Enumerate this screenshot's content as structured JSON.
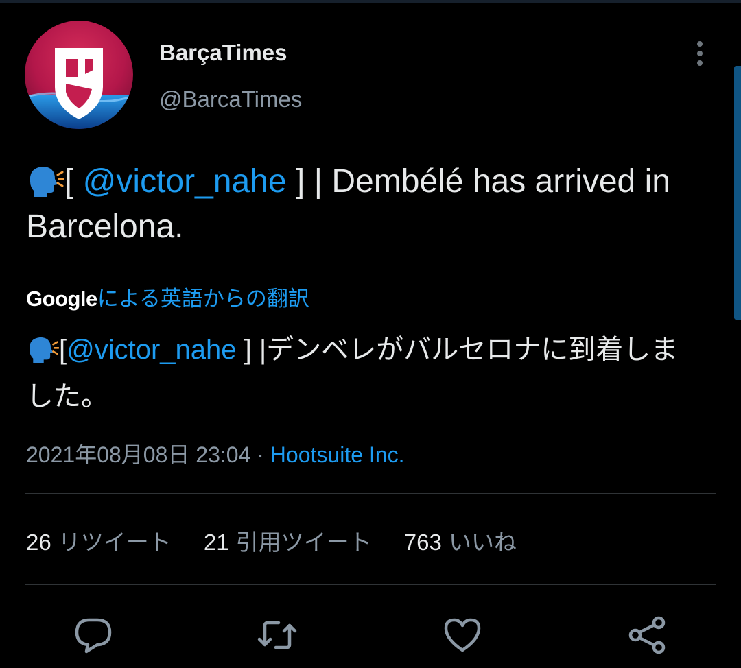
{
  "author": {
    "display_name": "BarçaTimes",
    "handle": "@BarcaTimes",
    "avatar": "barcatimes-logo"
  },
  "tweet": {
    "mention": "@victor_nahe",
    "text_open": "[ ",
    "text_close": " ] |  Dembélé has arrived in Barcelona."
  },
  "translation": {
    "google_label": "Google",
    "by_label": "による英語からの翻訳",
    "text_open": "[",
    "mention": "@victor_nahe",
    "text_close": " ] |デンベレがバルセロナに到着しました。"
  },
  "meta": {
    "timestamp": "2021年08月08日 23:04",
    "separator": "·",
    "source": "Hootsuite Inc."
  },
  "stats": [
    {
      "count": "26",
      "label": "リツイート"
    },
    {
      "count": "21",
      "label": "引用ツイート"
    },
    {
      "count": "763",
      "label": "いいね"
    }
  ],
  "actions": [
    "reply-icon",
    "retweet-icon",
    "like-icon",
    "share-icon"
  ],
  "colors": {
    "background": "#000000",
    "text": "#e7e9ea",
    "secondary": "#8b98a5",
    "accent": "#1d9bf0",
    "divider": "#2f3336"
  }
}
